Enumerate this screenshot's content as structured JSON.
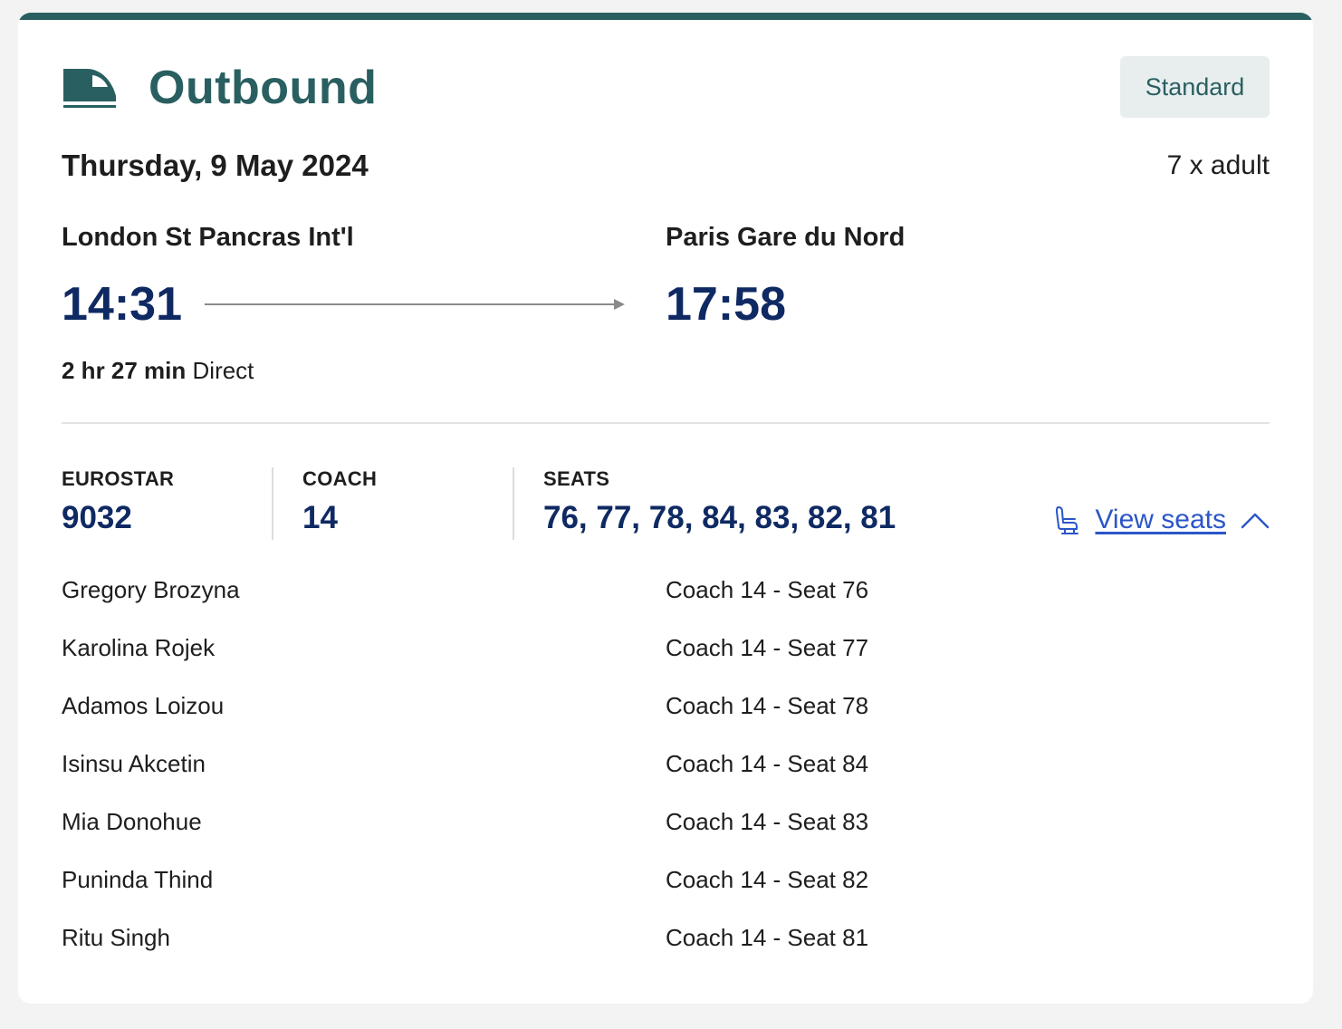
{
  "journey": {
    "title": "Outbound",
    "fare_class": "Standard",
    "date": "Thursday, 9 May 2024",
    "passengers_summary": "7 x adult",
    "origin": {
      "station": "London St Pancras Int'l",
      "time": "14:31"
    },
    "destination": {
      "station": "Paris Gare du Nord",
      "time": "17:58"
    },
    "duration": "2 hr 27 min",
    "stops": "Direct"
  },
  "details": {
    "train_label": "EUROSTAR",
    "train_number": "9032",
    "coach_label": "COACH",
    "coach_number": "14",
    "seats_label": "SEATS",
    "seats_list": "76, 77, 78, 84, 83, 82, 81",
    "view_seats_label": "View seats"
  },
  "passengers": [
    {
      "name": "Gregory Brozyna",
      "seat": "Coach 14 - Seat 76"
    },
    {
      "name": "Karolina Rojek",
      "seat": "Coach 14 - Seat 77"
    },
    {
      "name": "Adamos Loizou",
      "seat": "Coach 14 - Seat 78"
    },
    {
      "name": "Isinsu Akcetin",
      "seat": "Coach 14 - Seat 84"
    },
    {
      "name": "Mia Donohue",
      "seat": "Coach 14 - Seat 83"
    },
    {
      "name": "Puninda Thind",
      "seat": "Coach 14 - Seat 82"
    },
    {
      "name": "Ritu Singh",
      "seat": "Coach 14 - Seat 81"
    }
  ],
  "icons": {
    "header": "train-icon",
    "seat": "seat-icon",
    "toggle": "chevron-up-icon"
  },
  "colors": {
    "brand": "#2a5f61",
    "time_text": "#0f2a63",
    "link": "#2b56c8",
    "badge_bg": "#e8eeee"
  }
}
